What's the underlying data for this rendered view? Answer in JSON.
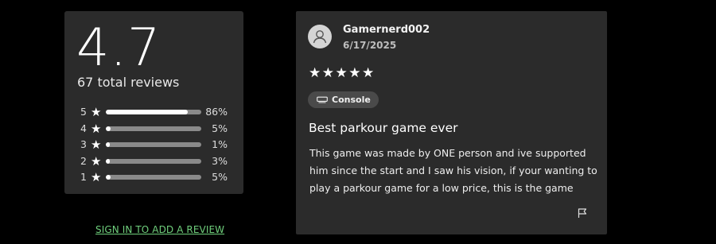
{
  "summary": {
    "average_rating": "4.7",
    "total_reviews_label": "67 total reviews",
    "distribution": [
      {
        "stars": "5",
        "percent_label": "86%",
        "fraction": 0.86
      },
      {
        "stars": "4",
        "percent_label": "5%",
        "fraction": 0.05
      },
      {
        "stars": "3",
        "percent_label": "1%",
        "fraction": 0.01
      },
      {
        "stars": "2",
        "percent_label": "3%",
        "fraction": 0.03
      },
      {
        "stars": "1",
        "percent_label": "5%",
        "fraction": 0.05
      }
    ],
    "star_glyph": "★"
  },
  "sign_in_link": "SIGN IN TO ADD A REVIEW",
  "review": {
    "author": "Gamernerd002",
    "date": "6/17/2025",
    "rating": 5,
    "stars_display": "★★★★★",
    "platform": "Console",
    "title": "Best parkour game ever",
    "body": "This game was made by ONE person and ive supported him since the start and I saw his vision, if your wanting to play a parkour game for a low price, this is the game"
  },
  "colors": {
    "background": "#000000",
    "card": "#2b2b2b",
    "link": "#6fcf7c",
    "bar_track": "#8a8a8a",
    "bar_fill": "#ffffff",
    "badge": "#4a4a4a"
  },
  "icons": {
    "avatar": "user-icon",
    "platform": "console-icon",
    "report": "flag-icon",
    "star": "star-icon"
  }
}
